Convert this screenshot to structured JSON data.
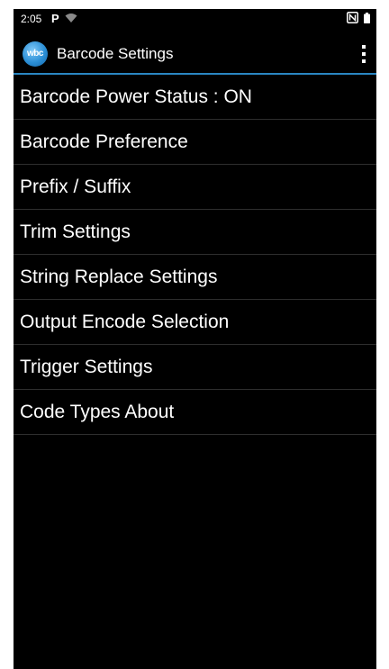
{
  "status_bar": {
    "time": "2:05",
    "icons": [
      "p-notification-icon",
      "wifi-icon",
      "nfc-icon",
      "battery-icon"
    ],
    "p_glyph": "P"
  },
  "app_bar": {
    "logo_text": "wbc",
    "title": "Barcode Settings",
    "accent_color": "#2a86c2"
  },
  "menu": {
    "items": [
      {
        "label": "Barcode Power Status : ON"
      },
      {
        "label": "Barcode Preference"
      },
      {
        "label": "Prefix / Suffix"
      },
      {
        "label": "Trim Settings"
      },
      {
        "label": "String Replace Settings"
      },
      {
        "label": "Output Encode Selection"
      },
      {
        "label": "Trigger Settings"
      },
      {
        "label": "Code Types About"
      }
    ]
  }
}
